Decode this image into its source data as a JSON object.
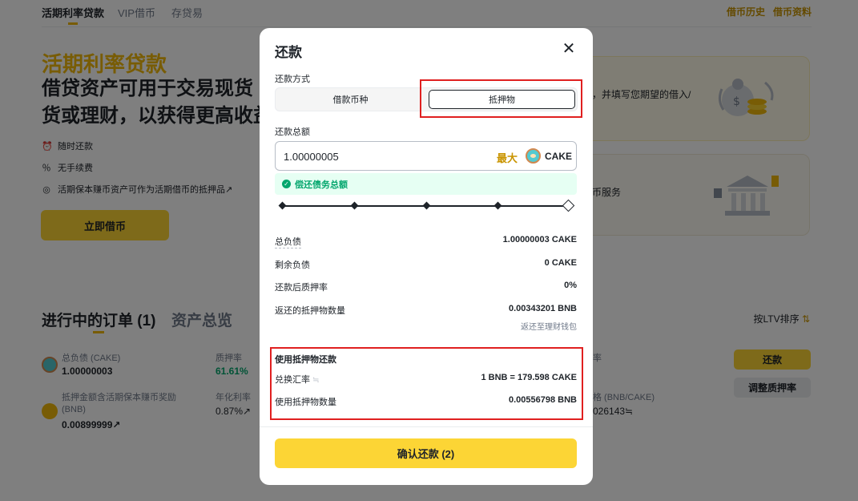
{
  "nav": {
    "tabs": [
      "活期利率贷款",
      "VIP借币",
      "存贷易"
    ],
    "links": [
      "借币历史",
      "借币资料"
    ]
  },
  "hero": {
    "title": "活期利率贷款",
    "subtitle_line1": "借贷资产可用于交易现货",
    "subtitle_line2": "货或理财，以获得更高收益",
    "features": [
      "随时还款",
      "无手续费",
      "活期保本赚币资产可作为活期借币的抵押品↗"
    ],
    "feature_icons": [
      "alarm-icon",
      "percent-icon",
      "target-icon"
    ],
    "cta": "立即借币"
  },
  "cards": {
    "card1_text": "，并填写您期望的借入/",
    "card2_text": "币服务"
  },
  "orders": {
    "title": "进行中的订单 (1)",
    "tab2": "资产总览",
    "sort": "按LTV排序",
    "row1": {
      "label": "总负债 (CAKE)",
      "value": "1.00000003",
      "ltv_label": "质押率",
      "ltv_value": "61.61%",
      "right_label": "率"
    },
    "row2": {
      "label_line1": "抵押金额含活期保本赚币奖励",
      "label_line2": "(BNB)",
      "value": "0.00899999↗",
      "apr_label": "年化利率",
      "apr_value": "0.87%↗",
      "right_label": "格 (BNB/CAKE)",
      "right_value": "026143≒"
    },
    "repay_btn": "还款",
    "adjust_btn": "调整质押率"
  },
  "modal": {
    "title": "还款",
    "close": "✕",
    "method_label": "还款方式",
    "method_options": [
      "借款币种",
      "抵押物"
    ],
    "method_selected": "抵押物",
    "amount_label": "还款总额",
    "amount_value": "1.00000005",
    "max": "最大",
    "coin": "CAKE",
    "notice": "偿还债务总额",
    "slider_percent": 100,
    "details": [
      {
        "label": "总负债",
        "value": "1.00000003 CAKE"
      },
      {
        "label": "剩余负债",
        "value": "0 CAKE"
      },
      {
        "label": "还款后质押率",
        "value": "0%"
      },
      {
        "label": "返还的抵押物数量",
        "value": "0.00343201 BNB"
      }
    ],
    "return_note": "返还至理财钱包",
    "collateral_section": {
      "title": "使用抵押物还款",
      "rate_label": "兑换汇率",
      "rate_icon": "≒",
      "rate_value": "1 BNB = 179.598 CAKE",
      "qty_label": "使用抵押物数量",
      "qty_value": "0.00556798 BNB"
    },
    "confirm": "确认还款 (2)"
  },
  "colors": {
    "accent": "#fcd535",
    "brand_text": "#f0b90b",
    "success": "#03a66d",
    "highlight": "#e02020"
  }
}
